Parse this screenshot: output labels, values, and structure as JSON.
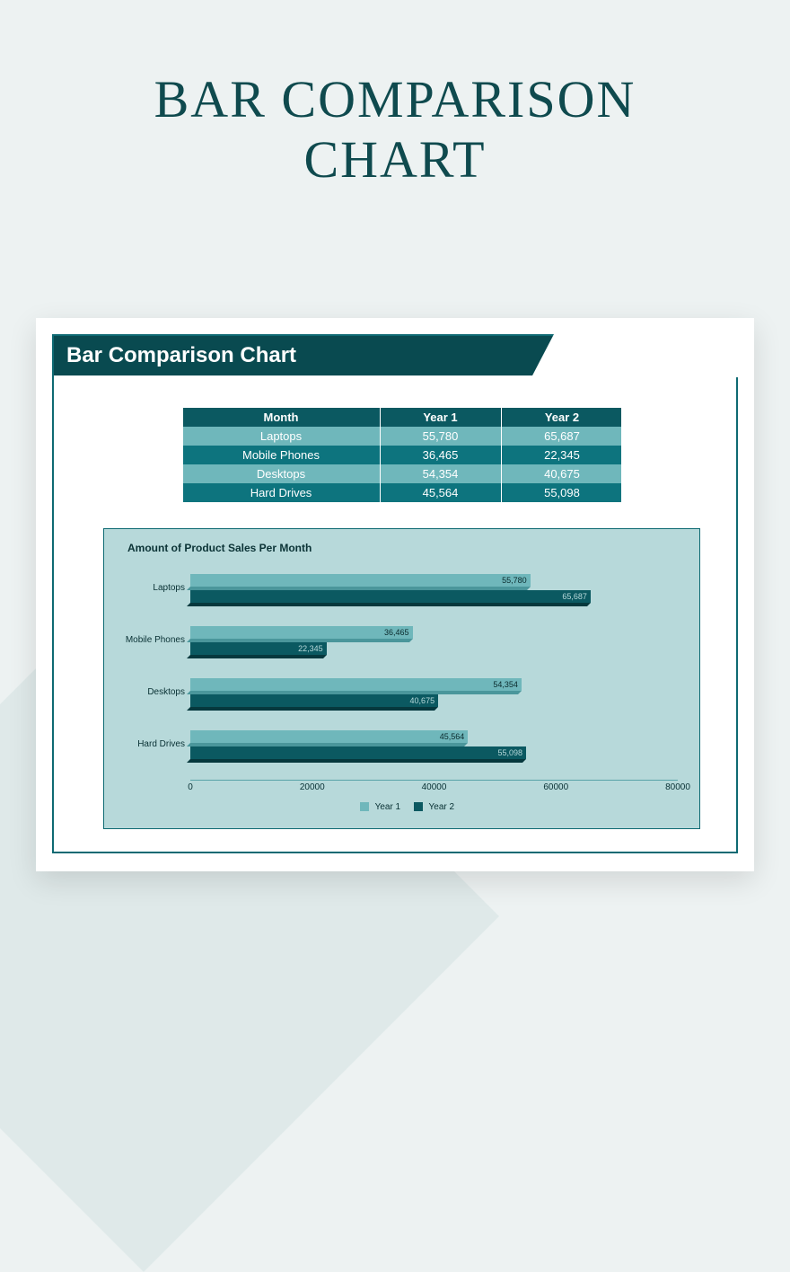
{
  "page": {
    "title_line1": "BAR COMPARISON",
    "title_line2": "CHART"
  },
  "panel": {
    "header": "Bar Comparison Chart"
  },
  "table": {
    "headers": [
      "Month",
      "Year 1",
      "Year 2"
    ],
    "rows": [
      {
        "label": "Laptops",
        "y1": "55,780",
        "y2": "65,687"
      },
      {
        "label": "Mobile Phones",
        "y1": "36,465",
        "y2": "22,345"
      },
      {
        "label": "Desktops",
        "y1": "54,354",
        "y2": "40,675"
      },
      {
        "label": "Hard Drives",
        "y1": "45,564",
        "y2": "55,098"
      }
    ]
  },
  "chart": {
    "title": "Amount of Product Sales Per Month",
    "xticks": [
      "0",
      "20000",
      "40000",
      "60000",
      "80000"
    ],
    "legend": [
      "Year 1",
      "Year 2"
    ]
  },
  "chart_data": {
    "type": "bar",
    "orientation": "horizontal",
    "title": "Amount of Product Sales Per Month",
    "xlabel": "",
    "ylabel": "",
    "xlim": [
      0,
      80000
    ],
    "categories": [
      "Laptops",
      "Mobile Phones",
      "Desktops",
      "Hard Drives"
    ],
    "series": [
      {
        "name": "Year 1",
        "values": [
          55780,
          36465,
          54354,
          45564
        ]
      },
      {
        "name": "Year 2",
        "values": [
          65687,
          22345,
          40675,
          55098
        ]
      }
    ]
  },
  "colors": {
    "brand_dark": "#094a50",
    "brand_mid": "#0d747e",
    "brand_light": "#6fb7bb",
    "chart_bg": "#b7d9da"
  }
}
